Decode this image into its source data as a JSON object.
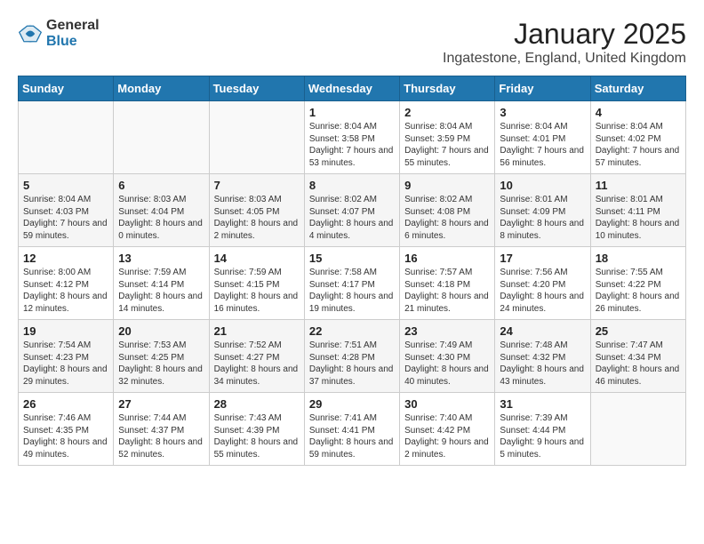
{
  "header": {
    "logo_general": "General",
    "logo_blue": "Blue",
    "month_title": "January 2025",
    "location": "Ingatestone, England, United Kingdom"
  },
  "days_of_week": [
    "Sunday",
    "Monday",
    "Tuesday",
    "Wednesday",
    "Thursday",
    "Friday",
    "Saturday"
  ],
  "weeks": [
    [
      {
        "day": "",
        "info": ""
      },
      {
        "day": "",
        "info": ""
      },
      {
        "day": "",
        "info": ""
      },
      {
        "day": "1",
        "info": "Sunrise: 8:04 AM\nSunset: 3:58 PM\nDaylight: 7 hours\nand 53 minutes."
      },
      {
        "day": "2",
        "info": "Sunrise: 8:04 AM\nSunset: 3:59 PM\nDaylight: 7 hours\nand 55 minutes."
      },
      {
        "day": "3",
        "info": "Sunrise: 8:04 AM\nSunset: 4:01 PM\nDaylight: 7 hours\nand 56 minutes."
      },
      {
        "day": "4",
        "info": "Sunrise: 8:04 AM\nSunset: 4:02 PM\nDaylight: 7 hours\nand 57 minutes."
      }
    ],
    [
      {
        "day": "5",
        "info": "Sunrise: 8:04 AM\nSunset: 4:03 PM\nDaylight: 7 hours\nand 59 minutes."
      },
      {
        "day": "6",
        "info": "Sunrise: 8:03 AM\nSunset: 4:04 PM\nDaylight: 8 hours\nand 0 minutes."
      },
      {
        "day": "7",
        "info": "Sunrise: 8:03 AM\nSunset: 4:05 PM\nDaylight: 8 hours\nand 2 minutes."
      },
      {
        "day": "8",
        "info": "Sunrise: 8:02 AM\nSunset: 4:07 PM\nDaylight: 8 hours\nand 4 minutes."
      },
      {
        "day": "9",
        "info": "Sunrise: 8:02 AM\nSunset: 4:08 PM\nDaylight: 8 hours\nand 6 minutes."
      },
      {
        "day": "10",
        "info": "Sunrise: 8:01 AM\nSunset: 4:09 PM\nDaylight: 8 hours\nand 8 minutes."
      },
      {
        "day": "11",
        "info": "Sunrise: 8:01 AM\nSunset: 4:11 PM\nDaylight: 8 hours\nand 10 minutes."
      }
    ],
    [
      {
        "day": "12",
        "info": "Sunrise: 8:00 AM\nSunset: 4:12 PM\nDaylight: 8 hours\nand 12 minutes."
      },
      {
        "day": "13",
        "info": "Sunrise: 7:59 AM\nSunset: 4:14 PM\nDaylight: 8 hours\nand 14 minutes."
      },
      {
        "day": "14",
        "info": "Sunrise: 7:59 AM\nSunset: 4:15 PM\nDaylight: 8 hours\nand 16 minutes."
      },
      {
        "day": "15",
        "info": "Sunrise: 7:58 AM\nSunset: 4:17 PM\nDaylight: 8 hours\nand 19 minutes."
      },
      {
        "day": "16",
        "info": "Sunrise: 7:57 AM\nSunset: 4:18 PM\nDaylight: 8 hours\nand 21 minutes."
      },
      {
        "day": "17",
        "info": "Sunrise: 7:56 AM\nSunset: 4:20 PM\nDaylight: 8 hours\nand 24 minutes."
      },
      {
        "day": "18",
        "info": "Sunrise: 7:55 AM\nSunset: 4:22 PM\nDaylight: 8 hours\nand 26 minutes."
      }
    ],
    [
      {
        "day": "19",
        "info": "Sunrise: 7:54 AM\nSunset: 4:23 PM\nDaylight: 8 hours\nand 29 minutes."
      },
      {
        "day": "20",
        "info": "Sunrise: 7:53 AM\nSunset: 4:25 PM\nDaylight: 8 hours\nand 32 minutes."
      },
      {
        "day": "21",
        "info": "Sunrise: 7:52 AM\nSunset: 4:27 PM\nDaylight: 8 hours\nand 34 minutes."
      },
      {
        "day": "22",
        "info": "Sunrise: 7:51 AM\nSunset: 4:28 PM\nDaylight: 8 hours\nand 37 minutes."
      },
      {
        "day": "23",
        "info": "Sunrise: 7:49 AM\nSunset: 4:30 PM\nDaylight: 8 hours\nand 40 minutes."
      },
      {
        "day": "24",
        "info": "Sunrise: 7:48 AM\nSunset: 4:32 PM\nDaylight: 8 hours\nand 43 minutes."
      },
      {
        "day": "25",
        "info": "Sunrise: 7:47 AM\nSunset: 4:34 PM\nDaylight: 8 hours\nand 46 minutes."
      }
    ],
    [
      {
        "day": "26",
        "info": "Sunrise: 7:46 AM\nSunset: 4:35 PM\nDaylight: 8 hours\nand 49 minutes."
      },
      {
        "day": "27",
        "info": "Sunrise: 7:44 AM\nSunset: 4:37 PM\nDaylight: 8 hours\nand 52 minutes."
      },
      {
        "day": "28",
        "info": "Sunrise: 7:43 AM\nSunset: 4:39 PM\nDaylight: 8 hours\nand 55 minutes."
      },
      {
        "day": "29",
        "info": "Sunrise: 7:41 AM\nSunset: 4:41 PM\nDaylight: 8 hours\nand 59 minutes."
      },
      {
        "day": "30",
        "info": "Sunrise: 7:40 AM\nSunset: 4:42 PM\nDaylight: 9 hours\nand 2 minutes."
      },
      {
        "day": "31",
        "info": "Sunrise: 7:39 AM\nSunset: 4:44 PM\nDaylight: 9 hours\nand 5 minutes."
      },
      {
        "day": "",
        "info": ""
      }
    ]
  ]
}
